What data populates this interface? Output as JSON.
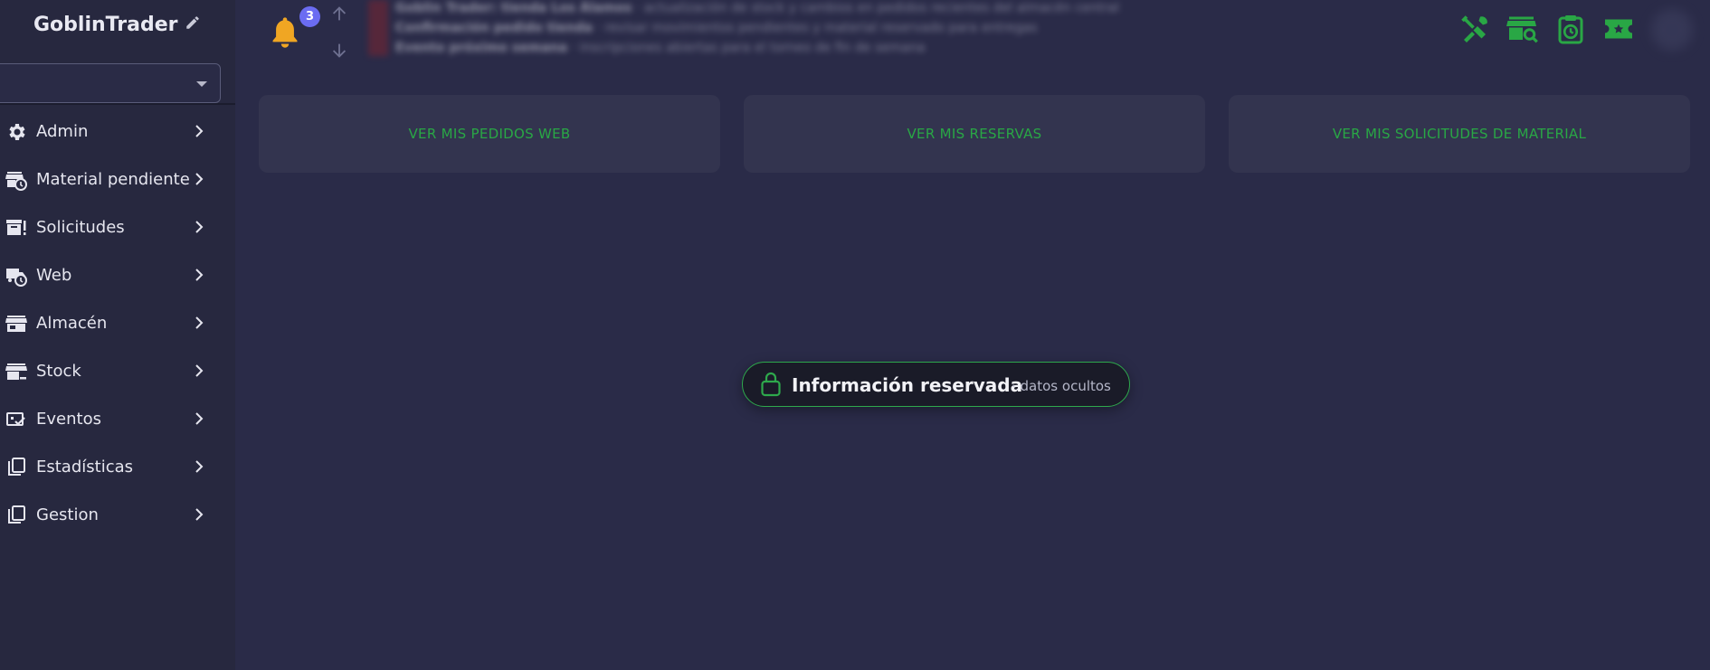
{
  "app": {
    "title": "GoblinTrader"
  },
  "sidebar": {
    "select": {
      "value": ""
    },
    "items": [
      {
        "label": "Admin",
        "icon": "gear-icon"
      },
      {
        "label": "Material pendiente",
        "icon": "store-clock-icon"
      },
      {
        "label": "Solicitudes",
        "icon": "archive-alert-icon"
      },
      {
        "label": "Web",
        "icon": "truck-clock-icon"
      },
      {
        "label": "Almacén",
        "icon": "storefront-icon"
      },
      {
        "label": "Stock",
        "icon": "warehouse-minus-icon"
      },
      {
        "label": "Eventos",
        "icon": "event-check-icon"
      },
      {
        "label": "Estadísticas",
        "icon": "copy-icon"
      },
      {
        "label": "Gestion",
        "icon": "copy-icon"
      }
    ]
  },
  "topbar": {
    "notifications_count": "3",
    "ticker": [
      {
        "bold": "Goblin Trader: tienda Los Álamos",
        "rest": " · actualización de stock y cambios en pedidos recientes del almacén central"
      },
      {
        "bold": "Confirmación pedido tienda",
        "rest": " · revisar movimientos pendientes y material reservado para entregas"
      },
      {
        "bold": "Evento próximo semana",
        "rest": " · inscripciones abiertas para el torneo de fin de semana"
      }
    ],
    "tools": [
      "tools-icon",
      "store-search-icon",
      "clipboard-clock-icon",
      "ticket-icon"
    ]
  },
  "cards": [
    {
      "label": "VER MIS PEDIDOS WEB"
    },
    {
      "label": "VER MIS RESERVAS"
    },
    {
      "label": "VER MIS SOLICITUDES DE MATERIAL"
    }
  ],
  "privacy": {
    "title": "Información reservada",
    "subtitle": "· datos ocultos"
  },
  "colors": {
    "background": "#2a2b48",
    "sidebar": "#27283f",
    "accent_green": "#29a745",
    "badge": "#6b6cf2",
    "bell": "#f0a623"
  }
}
